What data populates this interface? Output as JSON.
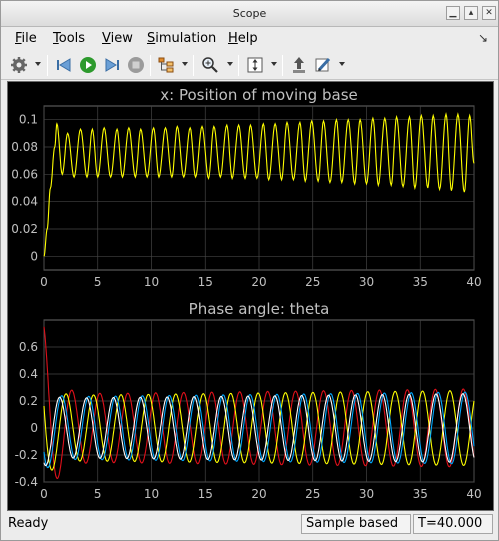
{
  "window": {
    "title": "Scope"
  },
  "menu": [
    {
      "mnemonic": "F",
      "rest": "ile"
    },
    {
      "mnemonic": "T",
      "rest": "ools"
    },
    {
      "mnemonic": "V",
      "rest": "iew"
    },
    {
      "mnemonic": "S",
      "rest": "imulation"
    },
    {
      "mnemonic": "H",
      "rest": "elp"
    }
  ],
  "toolbar_icons": [
    "gear-icon",
    "step-back-icon",
    "run-icon",
    "step-forward-icon",
    "stop-icon",
    "signal-hierarchy-icon",
    "zoom-icon",
    "scale-axes-icon",
    "highlight-block-icon",
    "edit-style-icon"
  ],
  "colors": {
    "axes_bg": "#000000",
    "grid": "#444444",
    "text": "#c0c0c0",
    "series_yellow": "#ffff00",
    "series_blue": "#00a8ff",
    "series_red": "#e0101a",
    "series_white": "#ffffff"
  },
  "status": {
    "left": "Ready",
    "mode": "Sample based",
    "time": "T=40.000"
  },
  "chart_data": [
    {
      "type": "line",
      "title": "x: Position of moving base",
      "xlim": [
        0,
        40
      ],
      "ylim": [
        -0.01,
        0.11
      ],
      "x_ticks": [
        0,
        5,
        10,
        15,
        20,
        25,
        30,
        35,
        40
      ],
      "y_ticks": [
        "0",
        "0.02",
        "0.04",
        "0.06",
        "0.08",
        "0.1"
      ],
      "grid": true,
      "series": [
        {
          "color": "yellow",
          "x": [
            0,
            0.3,
            0.6,
            1.0,
            1.2,
            1.7,
            2.2,
            2.8,
            3.4,
            4.0,
            4.5,
            5.0,
            5.6,
            6.2,
            6.8,
            7.3,
            7.9,
            8.5,
            9.0,
            9.6,
            10.2,
            10.7,
            11.3,
            11.9,
            12.4,
            13.0,
            13.6,
            14.1,
            14.7,
            15.3,
            15.8,
            16.4,
            17.0,
            17.5,
            18.1,
            18.7,
            19.2,
            19.8,
            20.4,
            20.9,
            21.5,
            22.1,
            22.6,
            23.2,
            23.8,
            24.3,
            24.9,
            25.5,
            26.0,
            26.6,
            27.2,
            27.7,
            28.3,
            28.9,
            29.4,
            30.0,
            30.6,
            31.1,
            31.7,
            32.3,
            32.8,
            33.4,
            34.0,
            34.5,
            35.1,
            35.7,
            36.2,
            36.8,
            37.4,
            37.9,
            38.5,
            39.1,
            39.6,
            40.0
          ],
          "y": [
            0.0,
            0.02,
            0.05,
            0.08,
            0.097,
            0.06,
            0.09,
            0.058,
            0.093,
            0.058,
            0.093,
            0.058,
            0.094,
            0.058,
            0.093,
            0.058,
            0.094,
            0.058,
            0.093,
            0.058,
            0.094,
            0.058,
            0.094,
            0.058,
            0.095,
            0.058,
            0.094,
            0.058,
            0.095,
            0.057,
            0.095,
            0.058,
            0.096,
            0.057,
            0.096,
            0.057,
            0.096,
            0.057,
            0.097,
            0.056,
            0.097,
            0.056,
            0.098,
            0.056,
            0.098,
            0.055,
            0.099,
            0.055,
            0.099,
            0.054,
            0.1,
            0.054,
            0.1,
            0.053,
            0.1,
            0.053,
            0.101,
            0.052,
            0.101,
            0.052,
            0.102,
            0.051,
            0.102,
            0.05,
            0.103,
            0.05,
            0.103,
            0.049,
            0.104,
            0.048,
            0.104,
            0.047,
            0.103,
            0.068
          ]
        }
      ]
    },
    {
      "type": "line",
      "title": "Phase angle: theta",
      "xlim": [
        0,
        40
      ],
      "ylim": [
        -0.4,
        0.8
      ],
      "x_ticks": [
        0,
        5,
        10,
        15,
        20,
        25,
        30,
        35,
        40
      ],
      "y_ticks": [
        "-0.4",
        "-0.2",
        "0",
        "0.2",
        "0.4",
        "0.6"
      ],
      "grid": true,
      "series": [
        {
          "color": "red",
          "amp": 0.25,
          "phase": 0.0,
          "start": 0.75,
          "period": 2.6,
          "decay": 0.9
        },
        {
          "color": "yellow",
          "amp": 0.24,
          "phase": 1.2,
          "start": 0.45,
          "period": 2.55,
          "decay": 0.7
        },
        {
          "color": "blue",
          "amp": 0.23,
          "phase": 2.1,
          "start": 0.35,
          "period": 2.5,
          "decay": 0.6
        },
        {
          "color": "white",
          "amp": 0.22,
          "phase": 2.6,
          "start": 0.3,
          "period": 2.5,
          "decay": 0.6
        }
      ]
    }
  ]
}
